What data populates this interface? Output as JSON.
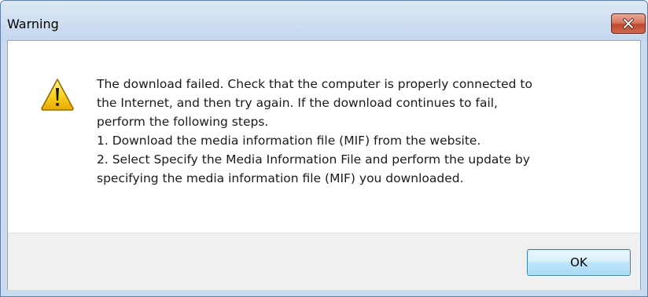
{
  "window": {
    "title": "Warning"
  },
  "message": {
    "lines": [
      "The download failed. Check that the computer is properly connected to",
      "the Internet, and then try again. If the download continues to fail,",
      "perform the following steps.",
      "1. Download the media information file (MIF) from the website.",
      "2. Select Specify the Media Information File and perform the update by",
      "specifying the media information file (MIF) you downloaded."
    ]
  },
  "buttons": {
    "ok_label": "OK"
  },
  "icons": {
    "dialog_icon": "warning-icon",
    "close": "close-icon"
  },
  "colors": {
    "close_button": "#c8553d",
    "title_bar": "#cfdff1",
    "warning_yellow": "#f5c400"
  }
}
